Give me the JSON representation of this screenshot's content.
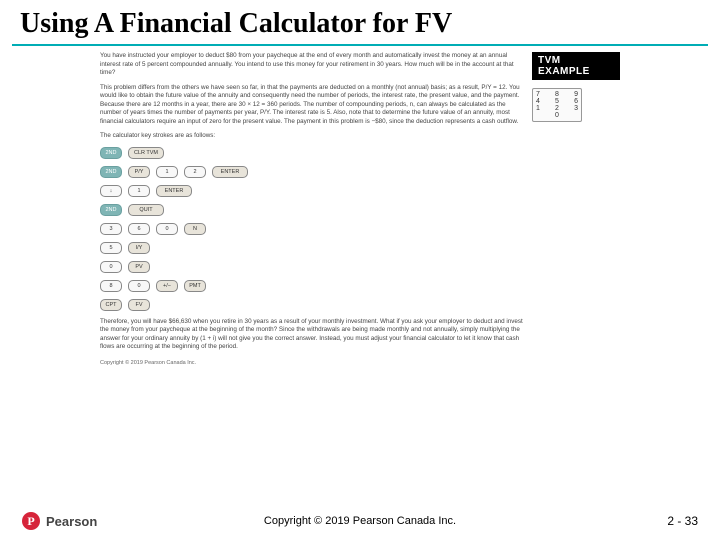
{
  "title": "Using A Financial Calculator for FV",
  "sidebar": {
    "badge": "TVM EXAMPLE",
    "keypad": [
      [
        "7",
        "8",
        "9"
      ],
      [
        "4",
        "5",
        "6"
      ],
      [
        "1",
        "2",
        "3"
      ]
    ],
    "keypad_zero": "0"
  },
  "body": {
    "para1": "You have instructed your employer to deduct $80 from your paycheque at the end of every month and automatically invest the money at an annual interest rate of 5 percent compounded annually. You intend to use this money for your retirement in 30 years. How much will be in the account at that time?",
    "para2": "This problem differs from the others we have seen so far, in that the payments are deducted on a monthly (not annual) basis; as a result, P/Y = 12. You would like to obtain the future value of the annuity and consequently need the number of periods, the interest rate, the present value, and the payment. Because there are 12 months in a year, there are 30 × 12 = 360 periods. The number of compounding periods, n, can always be calculated as the number of years times the number of payments per year, P/Y. The interest rate is 5. Also, note that to determine the future value of an annuity, most financial calculators require an input of zero for the present value. The payment in this problem is −$80, since the deduction represents a cash outflow.",
    "keystroke_intro": "The calculator key strokes are as follows:",
    "para3": "Therefore, you will have $66,630 when you retire in 30 years as a result of your monthly investment. What if you ask your employer to deduct and invest the money from your paycheque at the beginning of the month? Since the withdrawals are being made monthly and not annually, simply multiplying the answer for your ordinary annuity by (1 + i) will not give you the correct answer. Instead, you must adjust your financial calculator to let it know that cash flows are occurring at the beginning of the period.",
    "source": "Copyright © 2019 Pearson Canada Inc."
  },
  "keystrokes": [
    [
      {
        "t": "2ND",
        "c": "teal"
      },
      {
        "t": "CLR TVM",
        "c": "func wide"
      }
    ],
    [
      {
        "t": "2ND",
        "c": "teal"
      },
      {
        "t": "P/Y",
        "c": "func"
      },
      {
        "t": "1",
        "c": ""
      },
      {
        "t": "2",
        "c": ""
      },
      {
        "t": "ENTER",
        "c": "func wide"
      }
    ],
    [
      {
        "t": "↓",
        "c": ""
      },
      {
        "t": "1",
        "c": ""
      },
      {
        "t": "ENTER",
        "c": "func wide"
      }
    ],
    [
      {
        "t": "2ND",
        "c": "teal"
      },
      {
        "t": "QUIT",
        "c": "func wide"
      }
    ],
    [
      {
        "t": "3",
        "c": ""
      },
      {
        "t": "6",
        "c": ""
      },
      {
        "t": "0",
        "c": ""
      },
      {
        "t": "N",
        "c": "func"
      }
    ],
    [
      {
        "t": "5",
        "c": ""
      },
      {
        "t": "I/Y",
        "c": "func"
      }
    ],
    [
      {
        "t": "0",
        "c": ""
      },
      {
        "t": "PV",
        "c": "func"
      }
    ],
    [
      {
        "t": "8",
        "c": ""
      },
      {
        "t": "0",
        "c": ""
      },
      {
        "t": "+/−",
        "c": "func"
      },
      {
        "t": "PMT",
        "c": "func"
      }
    ],
    [
      {
        "t": "CPT",
        "c": "func"
      },
      {
        "t": "FV",
        "c": "func"
      }
    ]
  ],
  "footer": {
    "brand_letter": "P",
    "brand_name": "Pearson",
    "copyright": "Copyright © 2019 Pearson Canada Inc.",
    "page": "2 - 33"
  }
}
